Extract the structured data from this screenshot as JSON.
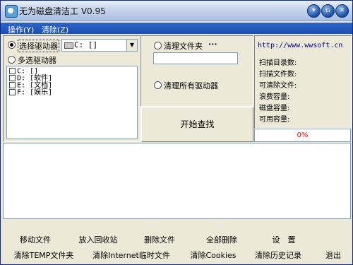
{
  "window": {
    "title": "无为磁盘清洁工 V0.95"
  },
  "title_buttons": {
    "minimize": "▾",
    "restore": "▫",
    "close": "✕"
  },
  "menu": {
    "operations": "操作(Y)",
    "clear": "清除(Z)"
  },
  "left": {
    "select_drive_label": "选择驱动器",
    "multi_drive_label": "多选驱动器",
    "combo_value": "C: []",
    "drives": [
      "C: []",
      "D: [软件]",
      "E: [文档]",
      "F: [娱乐]"
    ]
  },
  "middle": {
    "clean_folder_label": "清理文件夹",
    "browse_label": "···",
    "folder_value": "",
    "clean_all_label": "清理所有驱动器",
    "start_button": "开始查找"
  },
  "info": {
    "url": "http://www.wwsoft.cn",
    "stats": [
      "扫描目录数:",
      "扫描文件数:",
      "可清除文件:",
      "浪费容量:",
      "磁盘容量:",
      "可用容量:"
    ],
    "progress_text": "0%"
  },
  "bottom_row1": [
    "移动文件",
    "放入回收站",
    "删除文件",
    "全部删除",
    "设　置"
  ],
  "bottom_row2": [
    "清除TEMP文件夹",
    "清除Internet临时文件",
    "清除Cookies",
    "清除历史记录",
    "退出"
  ]
}
